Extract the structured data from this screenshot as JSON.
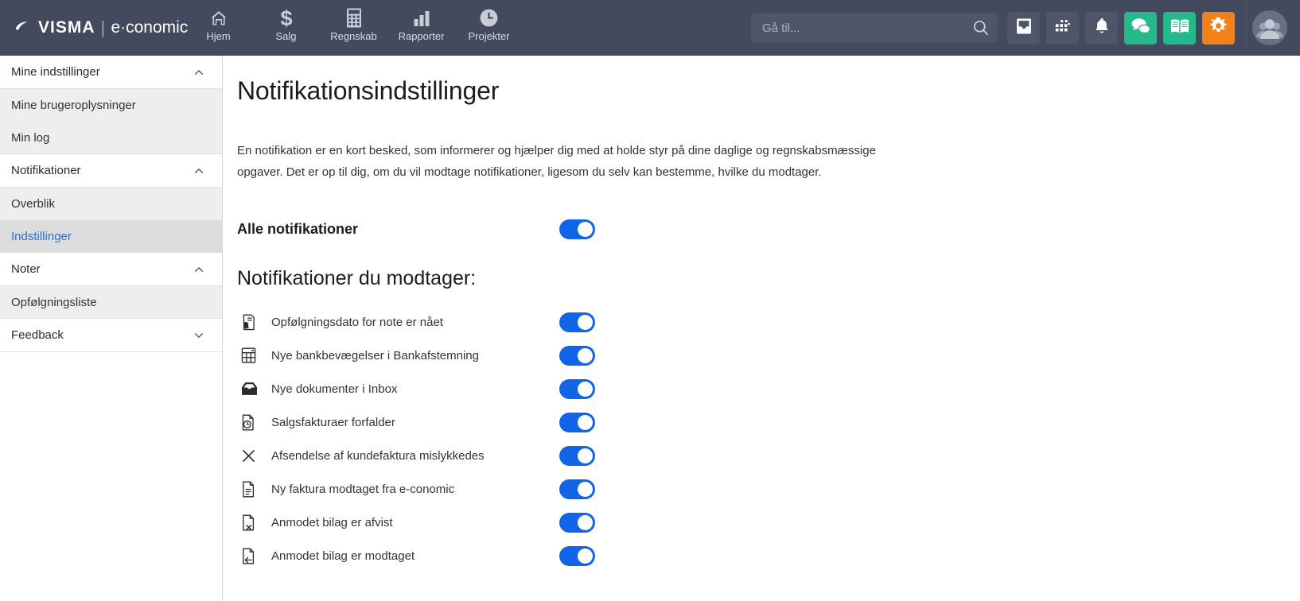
{
  "topbar": {
    "brand": {
      "visma": "VISMA",
      "separator": "|",
      "product": "e·conomic",
      "logo_icon": "visma-logo-icon"
    },
    "nav": [
      {
        "label": "Hjem",
        "icon": "home-icon"
      },
      {
        "label": "Salg",
        "icon": "dollar-icon"
      },
      {
        "label": "Regnskab",
        "icon": "calculator-icon"
      },
      {
        "label": "Rapporter",
        "icon": "bar-chart-icon"
      },
      {
        "label": "Projekter",
        "icon": "clock-icon"
      }
    ],
    "search": {
      "placeholder": "Gå til...",
      "value": "",
      "icon": "search-icon"
    },
    "actions": [
      {
        "name": "inbox-button",
        "icon": "inbox-icon",
        "color": "#4e5569"
      },
      {
        "name": "apps-button",
        "icon": "apps-grid-icon",
        "color": "#4e5569"
      },
      {
        "name": "notifications-button",
        "icon": "bell-icon",
        "color": "#4e5569"
      },
      {
        "name": "chat-button",
        "icon": "chat-bubbles-icon",
        "color": "#25b88a"
      },
      {
        "name": "help-button",
        "icon": "book-icon",
        "color": "#25b88a"
      },
      {
        "name": "settings-button",
        "icon": "gear-icon",
        "color": "#f28016"
      }
    ],
    "avatar": {
      "icon": "users-avatar-icon"
    }
  },
  "sidebar": {
    "sections": [
      {
        "type": "group",
        "label": "Mine indstillinger",
        "chevron": "chevron-up-icon",
        "expanded": true
      },
      {
        "type": "sub",
        "label": "Mine brugeroplysninger",
        "selected": false
      },
      {
        "type": "sub",
        "label": "Min log",
        "selected": false,
        "last": true
      },
      {
        "type": "group",
        "label": "Notifikationer",
        "chevron": "chevron-up-icon",
        "expanded": true
      },
      {
        "type": "sub",
        "label": "Overblik",
        "selected": false
      },
      {
        "type": "sub",
        "label": "Indstillinger",
        "selected": true,
        "last": true
      },
      {
        "type": "group",
        "label": "Noter",
        "chevron": "chevron-up-icon",
        "expanded": true
      },
      {
        "type": "sub",
        "label": "Opfølgningsliste",
        "selected": false,
        "last": true
      },
      {
        "type": "group",
        "label": "Feedback",
        "chevron": "chevron-down-icon",
        "expanded": false
      }
    ]
  },
  "main": {
    "title": "Notifikationsindstillinger",
    "description": "En notifikation er en kort besked, som informerer og hjælper dig med at holde styr på dine daglige og regnskabsmæssige opgaver. Det er op til dig, om du vil modtage notifikationer, ligesom du selv kan bestemme, hvilke du modtager.",
    "all_notifications": {
      "label": "Alle notifikationer",
      "enabled": true
    },
    "section_title": "Notifikationer du modtager:",
    "notifications": [
      {
        "label": "Opfølgningsdato for note er nået",
        "icon": "note-bell-icon",
        "enabled": true
      },
      {
        "label": "Nye bankbevægelser i Bankafstemning",
        "icon": "calculator-icon",
        "enabled": true
      },
      {
        "label": "Nye dokumenter i Inbox",
        "icon": "inbox-tray-icon",
        "enabled": true
      },
      {
        "label": "Salgsfakturaer forfalder",
        "icon": "document-clock-icon",
        "enabled": true
      },
      {
        "label": "Afsendelse af kundefaktura mislykkedes",
        "icon": "close-x-icon",
        "enabled": true
      },
      {
        "label": "Ny faktura modtaget fra e-conomic",
        "icon": "document-lines-icon",
        "enabled": true
      },
      {
        "label": "Anmodet bilag er afvist",
        "icon": "document-x-icon",
        "enabled": true
      },
      {
        "label": "Anmodet bilag er modtaget",
        "icon": "document-arrow-icon",
        "enabled": true
      }
    ]
  },
  "colors": {
    "topbar_bg": "#434a5e",
    "toggle_on": "#1064e8",
    "accent_teal": "#25b88a",
    "accent_orange": "#f28016",
    "selected_link": "#2f6fd0"
  }
}
